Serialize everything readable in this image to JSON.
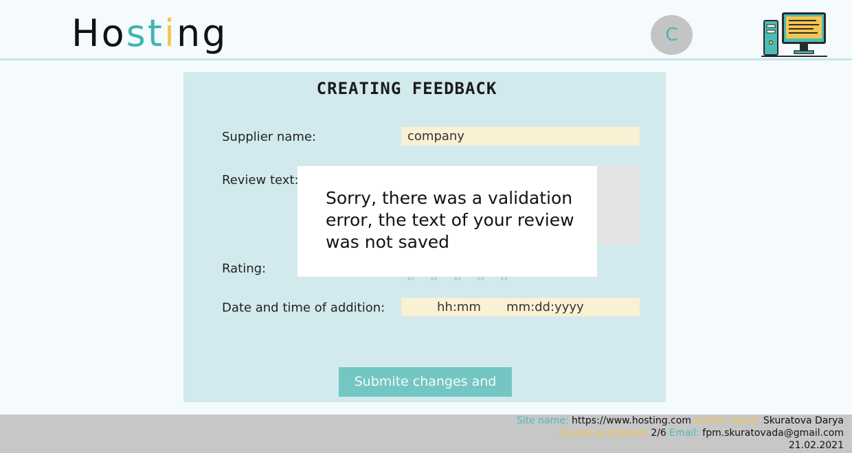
{
  "header": {
    "logo": {
      "part1": "Ho",
      "part2": "st",
      "part3": "i",
      "part4": "ng"
    },
    "avatar_initial": "C",
    "icon": "computer-icon"
  },
  "form": {
    "title": "CREATING FEEDBACK",
    "supplier_label": "Supplier name:",
    "supplier_value": "company",
    "review_label": "Review text:",
    "rating_label": "Rating:",
    "datetime_label": "Date and time of addition:",
    "time_placeholder": "hh:mm",
    "date_placeholder": "mm:dd:yyyy",
    "submit_label": "Submite changes and save"
  },
  "modal": {
    "message": "Sorry, there was a validation error, the text of your review was not saved"
  },
  "footer": {
    "site_key": "Site name:",
    "site_value": "https://www.hosting.com",
    "author_key": "Author name:",
    "author_value": "Skuratova Darya",
    "course_key": "Course and group:",
    "course_value": "2/6",
    "email_key": "Email:",
    "email_value": "fpm.skuratovada@gmail.com",
    "date": "21.02.2021"
  },
  "colors": {
    "accent_teal": "#42b5b0",
    "accent_yellow": "#f5c64e",
    "panel_bg": "#d2eaed",
    "field_bg": "#faf0d4"
  }
}
